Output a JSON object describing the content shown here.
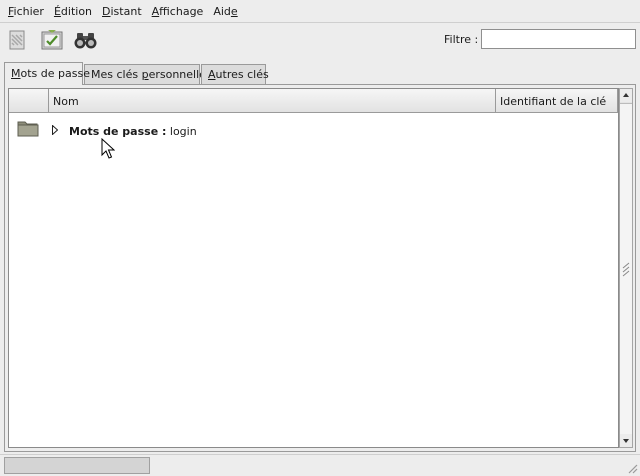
{
  "menubar": {
    "items": [
      {
        "key": "F",
        "rest": "ichier"
      },
      {
        "key": "É",
        "rest": "dition"
      },
      {
        "key": "D",
        "rest": "istant"
      },
      {
        "key": "A",
        "rest": "ffichage"
      },
      {
        "key": "Aid",
        "rest": "e",
        "underline_last": true
      }
    ]
  },
  "toolbar": {
    "icons": [
      "new-key-icon",
      "import-key-icon",
      "binoculars-icon"
    ]
  },
  "filter": {
    "label": "Filtre :",
    "value": ""
  },
  "tabs": [
    {
      "key": "M",
      "rest": "ots de passe",
      "active": true
    },
    {
      "pre": "Mes clés ",
      "key": "p",
      "rest": "ersonnelles",
      "active": false
    },
    {
      "key": "A",
      "rest": "utres clés",
      "active": false
    }
  ],
  "tree": {
    "columns": {
      "name": "Nom",
      "key_id": "Identifiant de la clé"
    },
    "rows": [
      {
        "bold": "Mots de passe :",
        "text": " login",
        "icon": "folder-icon",
        "expanded": false
      }
    ]
  },
  "status": {
    "progress": 0
  },
  "colors": {
    "window_bg": "#ededed",
    "tree_bg": "#ffffff",
    "border": "#9a9a9a"
  }
}
